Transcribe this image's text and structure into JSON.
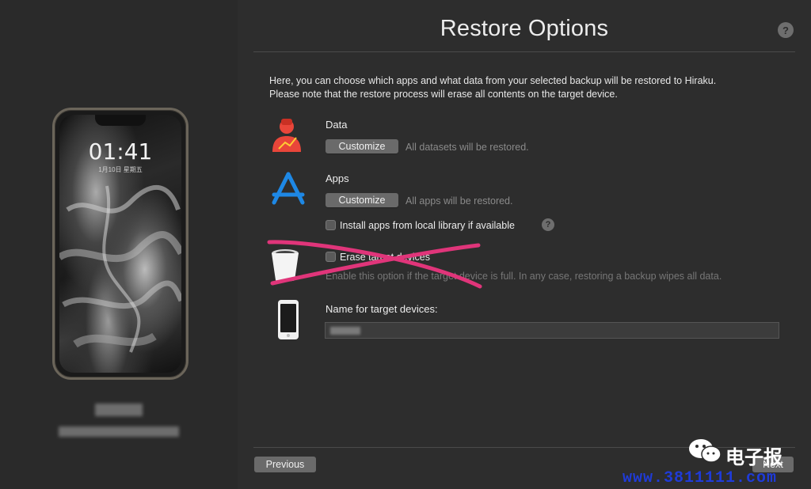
{
  "window": {
    "title": "Restore Options"
  },
  "sidebar": {
    "phone": {
      "time": "01:41",
      "date": "1月10日 星期五"
    }
  },
  "main": {
    "title": "Restore Options",
    "description_line1": "Here, you can choose which apps and what data from your selected backup will be restored to Hiraku.",
    "description_line2": "Please note that the restore process will erase all contents on the target device.",
    "data": {
      "label": "Data",
      "button": "Customize",
      "hint": "All datasets will be restored."
    },
    "apps": {
      "label": "Apps",
      "button": "Customize",
      "hint": "All apps will be restored.",
      "install_checkbox_label": "Install apps from local library if available"
    },
    "erase": {
      "label": "Erase target devices",
      "hint": "Enable this option if the target device is full. In any case, restoring a backup wipes all data."
    },
    "name": {
      "label": "Name for target devices:"
    },
    "help_glyph": "?"
  },
  "footer": {
    "previous": "Previous",
    "next": "Next"
  },
  "watermark": {
    "text": "电子报",
    "url": "www.3811111.com"
  },
  "colors": {
    "accent_red": "#e9463a",
    "accent_blue": "#1e88e5",
    "strike": "#e0357a"
  },
  "icons": [
    "data-person-icon",
    "app-store-icon",
    "trash-icon",
    "iphone-icon",
    "help-icon",
    "wechat-icon"
  ]
}
